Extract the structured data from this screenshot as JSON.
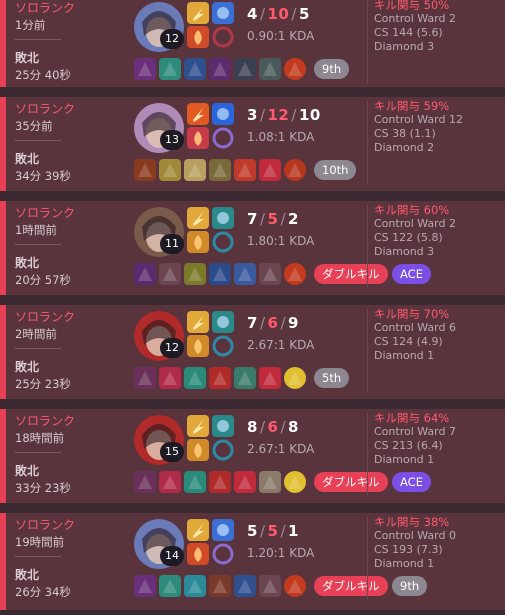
{
  "matches": [
    {
      "queue": "ソロランク",
      "ago": "1分前",
      "result": "敗北",
      "duration": "25分 40秒",
      "level": "12",
      "kills": "4",
      "deaths": "10",
      "assists": "5",
      "kda": "0.90:1 KDA",
      "tags": [
        {
          "text": "9th",
          "kind": "rank"
        }
      ],
      "kill_participation": "キル関与 50%",
      "control_ward": "Control Ward 2",
      "cs": "CS 144 (5.6)",
      "rank": "Diamond 3",
      "champ_color": "#6b7bb8",
      "spell1": "#e2a83a",
      "spell2": "#3c6fd4",
      "rune1": "#d04a28",
      "rune2": "#b03848",
      "items": [
        "#6a2f7a",
        "#2d8b7b",
        "#2f4f8f",
        "#5c2a6e",
        "#3a3f52",
        "#4a5a5a",
        "#c43a1e"
      ]
    },
    {
      "queue": "ソロランク",
      "ago": "35分前",
      "result": "敗北",
      "duration": "34分 39秒",
      "level": "13",
      "kills": "3",
      "deaths": "12",
      "assists": "10",
      "kda": "1.08:1 KDA",
      "tags": [
        {
          "text": "10th",
          "kind": "rank"
        }
      ],
      "kill_participation": "キル関与 59%",
      "control_ward": "Control Ward 12",
      "cs": "CS 38 (1.1)",
      "rank": "Diamond 2",
      "champ_color": "#b08bb8",
      "spell1": "#e05a22",
      "spell2": "#2a66d9",
      "rune1": "#c83a48",
      "rune2": "#8a6ad0",
      "items": [
        "#8a3a1e",
        "#a08a3a",
        "#b8a060",
        "#7a6a3a",
        "#c03a2a",
        "#c02a3a",
        "#b8361e"
      ]
    },
    {
      "queue": "ソロランク",
      "ago": "1時間前",
      "result": "敗北",
      "duration": "20分 57秒",
      "level": "11",
      "kills": "7",
      "deaths": "5",
      "assists": "2",
      "kda": "1.80:1 KDA",
      "tags": [
        {
          "text": "ダブルキル",
          "kind": "multi"
        },
        {
          "text": "ACE",
          "kind": "ace"
        }
      ],
      "kill_participation": "キル関与 60%",
      "control_ward": "Control Ward 2",
      "cs": "CS 122 (5.8)",
      "rank": "Diamond 3",
      "champ_color": "#7a5a4a",
      "spell1": "#e2a83a",
      "spell2": "#2a8a8a",
      "rune1": "#d08a2a",
      "rune2": "#2a8aa8",
      "items": [
        "#5c2a6e",
        "#6b4650",
        "#7a7a2a",
        "#2a4a8a",
        "#3a5aa0",
        "#6b4650",
        "#c43a1e"
      ]
    },
    {
      "queue": "ソロランク",
      "ago": "2時間前",
      "result": "敗北",
      "duration": "25分 23秒",
      "level": "12",
      "kills": "7",
      "deaths": "6",
      "assists": "9",
      "kda": "2.67:1 KDA",
      "tags": [
        {
          "text": "5th",
          "kind": "rank"
        }
      ],
      "kill_participation": "キル関与 70%",
      "control_ward": "Control Ward 6",
      "cs": "CS 124 (4.9)",
      "rank": "Diamond 1",
      "champ_color": "#b02a2a",
      "spell1": "#e2a83a",
      "spell2": "#2a8a8a",
      "rune1": "#d08a2a",
      "rune2": "#2a8aa8",
      "items": [
        "#6a2f5a",
        "#b02a4a",
        "#2a8a7a",
        "#b02a2a",
        "#3a7a6a",
        "#c02a3a",
        "#e0c030"
      ]
    },
    {
      "queue": "ソロランク",
      "ago": "18時間前",
      "result": "敗北",
      "duration": "33分 23秒",
      "level": "15",
      "kills": "8",
      "deaths": "6",
      "assists": "8",
      "kda": "2.67:1 KDA",
      "tags": [
        {
          "text": "ダブルキル",
          "kind": "multi"
        },
        {
          "text": "ACE",
          "kind": "ace"
        }
      ],
      "kill_participation": "キル関与 64%",
      "control_ward": "Control Ward 7",
      "cs": "CS 213 (6.4)",
      "rank": "Diamond 1",
      "champ_color": "#b02a2a",
      "spell1": "#e2a83a",
      "spell2": "#2a8a8a",
      "rune1": "#d08a2a",
      "rune2": "#2a8aa8",
      "items": [
        "#6a2f5a",
        "#b02a4a",
        "#2a8a7a",
        "#b02a2a",
        "#c02a3a",
        "#8a7a6a",
        "#e0c030"
      ]
    },
    {
      "queue": "ソロランク",
      "ago": "19時間前",
      "result": "敗北",
      "duration": "26分 34秒",
      "level": "14",
      "kills": "5",
      "deaths": "5",
      "assists": "1",
      "kda": "1.20:1 KDA",
      "tags": [
        {
          "text": "ダブルキル",
          "kind": "multi"
        },
        {
          "text": "9th",
          "kind": "rank"
        }
      ],
      "kill_participation": "キル関与 38%",
      "control_ward": "Control Ward 0",
      "cs": "CS 193 (7.3)",
      "rank": "Diamond 1",
      "champ_color": "#6b7bb8",
      "spell1": "#e2a83a",
      "spell2": "#3c6fd4",
      "rune1": "#d04a28",
      "rune2": "#8a6ad0",
      "items": [
        "#6a2f7a",
        "#2d8b7b",
        "#2a8a9a",
        "#7a3a2a",
        "#2f4f8f",
        "#6b4650",
        "#c43a1e"
      ]
    }
  ]
}
